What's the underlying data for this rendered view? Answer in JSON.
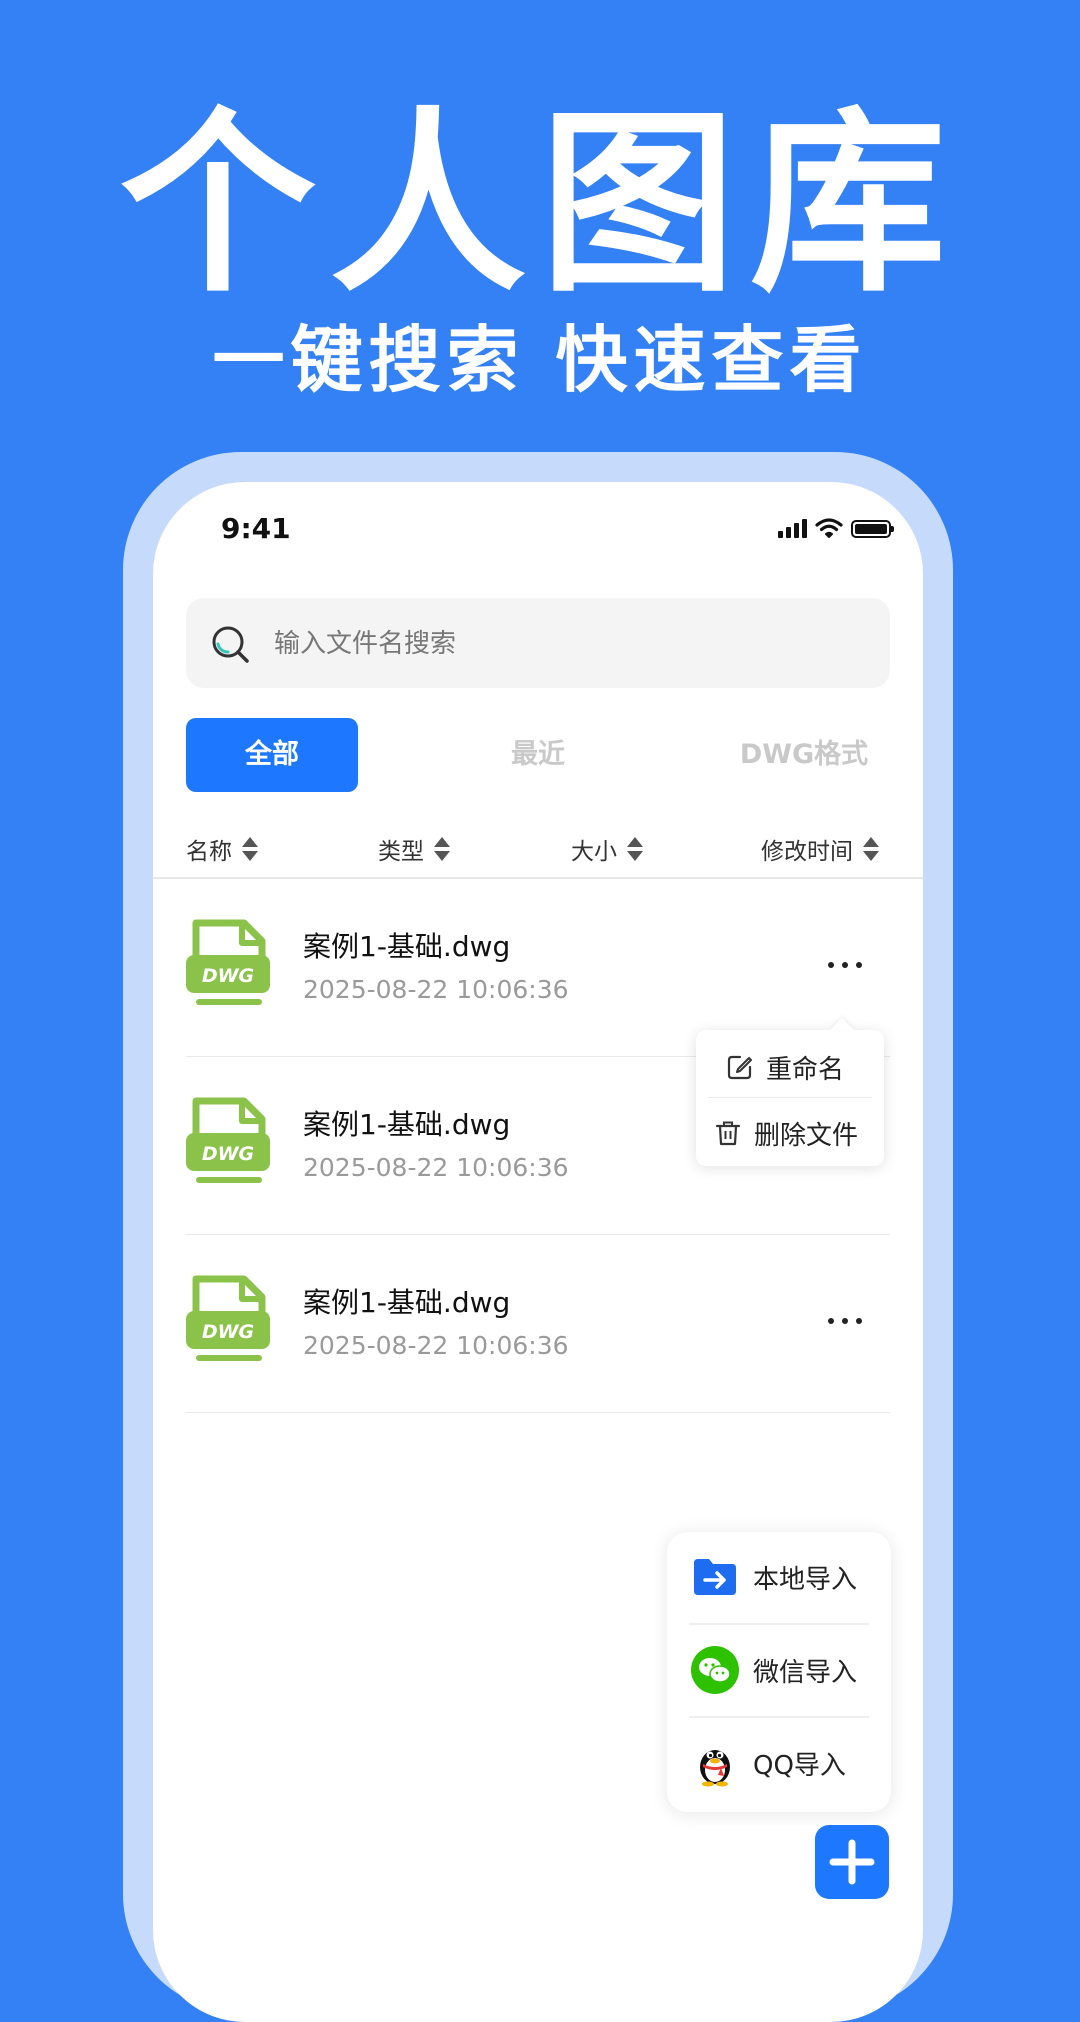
{
  "hero": {
    "title": "个人图库",
    "subtitle": "一键搜索 快速查看"
  },
  "status_bar": {
    "time": "9:41"
  },
  "search": {
    "placeholder": "输入文件名搜索"
  },
  "tabs": [
    {
      "label": "全部",
      "active": true
    },
    {
      "label": "最近",
      "active": false
    },
    {
      "label": "DWG格式",
      "active": false
    }
  ],
  "columns": [
    {
      "label": "名称"
    },
    {
      "label": "类型"
    },
    {
      "label": "大小"
    },
    {
      "label": "修改时间"
    }
  ],
  "files": [
    {
      "name": "案例1-基础.dwg",
      "date": "2025-08-22 10:06:36",
      "icon_label": "DWG"
    },
    {
      "name": "案例1-基础.dwg",
      "date": "2025-08-22 10:06:36",
      "icon_label": "DWG"
    },
    {
      "name": "案例1-基础.dwg",
      "date": "2025-08-22 10:06:36",
      "icon_label": "DWG"
    }
  ],
  "context_menu": {
    "rename": "重命名",
    "delete": "删除文件"
  },
  "import_menu": {
    "local": "本地导入",
    "wechat": "微信导入",
    "qq": "QQ导入"
  },
  "colors": {
    "background": "#3481f6",
    "accent": "#1e78ff",
    "file_icon": "#8bc34a",
    "wechat": "#2dc100"
  }
}
